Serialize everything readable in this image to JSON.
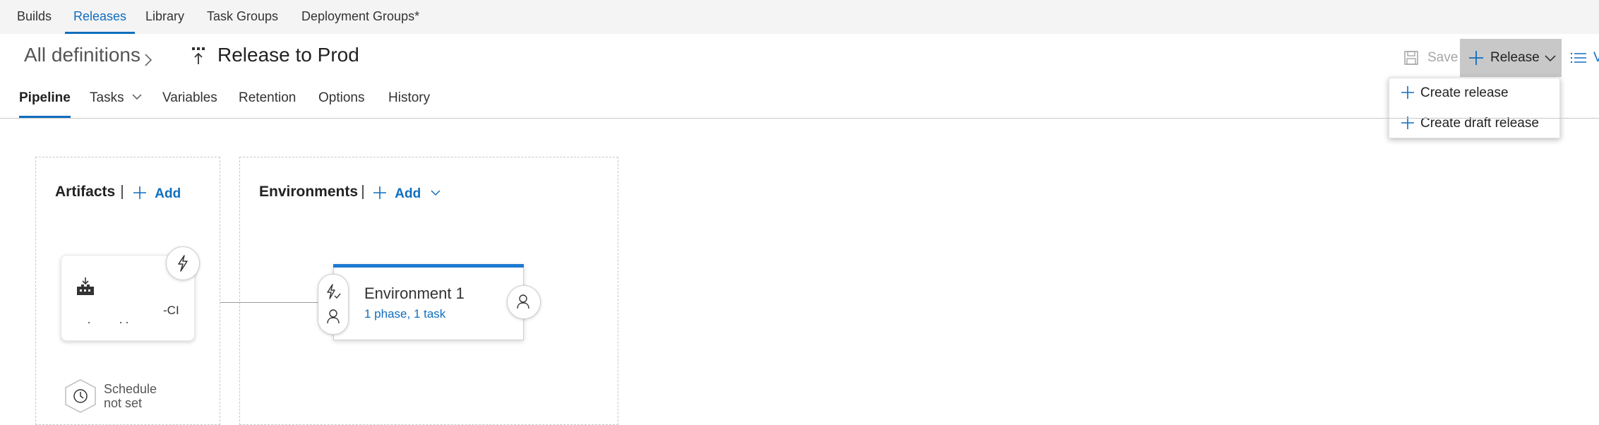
{
  "topnav": {
    "tabs": [
      {
        "label": "Builds"
      },
      {
        "label": "Releases"
      },
      {
        "label": "Library"
      },
      {
        "label": "Task Groups"
      },
      {
        "label": "Deployment Groups*"
      }
    ],
    "active_tab": "Releases"
  },
  "breadcrumb": {
    "root": "All definitions",
    "separator": ">",
    "title": "Release to Prod"
  },
  "toolbar": {
    "save_label": "Save",
    "release_label": "Release",
    "view_label": "V"
  },
  "release_menu": {
    "items": [
      {
        "label": "Create release",
        "icon": "plus-icon"
      },
      {
        "label": "Create draft release",
        "icon": "plus-icon"
      }
    ]
  },
  "subtabs": [
    {
      "label": "Pipeline"
    },
    {
      "label": "Tasks"
    },
    {
      "label": "Variables"
    },
    {
      "label": "Retention"
    },
    {
      "label": "Options"
    },
    {
      "label": "History"
    }
  ],
  "artifacts": {
    "header": "Artifacts",
    "add_label": "Add",
    "card": {
      "name": "-CI",
      "icon": "build-factory-icon",
      "trigger_icon": "lightning-icon"
    },
    "schedule": {
      "line1": "Schedule",
      "line2": "not set",
      "icon": "clock-icon"
    }
  },
  "environments": {
    "header": "Environments",
    "add_label": "Add",
    "items": [
      {
        "name": "Environment 1",
        "summary": "1 phase, 1 task",
        "pre_icons": [
          "lightning-check-icon",
          "person-icon"
        ],
        "post_icon": "person-icon"
      }
    ]
  },
  "colors": {
    "accent": "#106ebe",
    "env_bar": "#1e7ad2",
    "release_btn_bg": "#c8c8c8",
    "topnav_bg": "#f4f4f4"
  }
}
